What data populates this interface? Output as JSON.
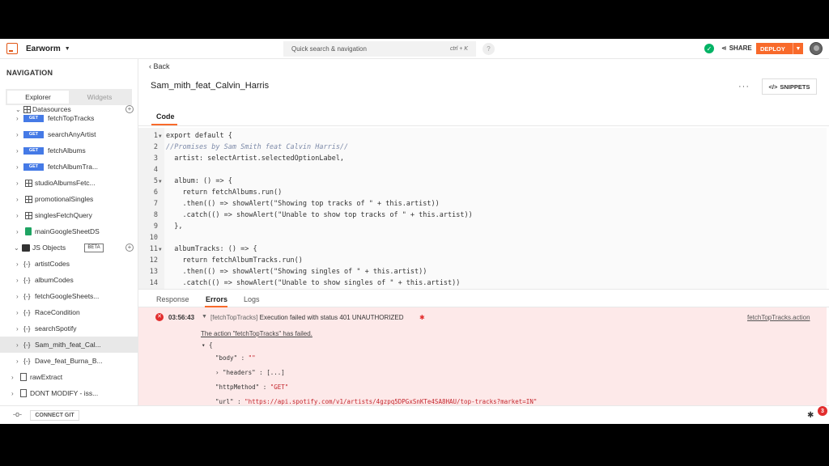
{
  "header": {
    "app_name": "Earworm",
    "search_placeholder": "Quick search & navigation",
    "search_shortcut": "ctrl + K",
    "help": "?",
    "share_label": "SHARE",
    "deploy_label": "DEPLOY"
  },
  "sidebar": {
    "title": "NAVIGATION",
    "tabs": [
      "Explorer",
      "Widgets"
    ],
    "datasources_label": "Datasources",
    "queries": [
      {
        "method": "GET",
        "label": "fetchTopTracks"
      },
      {
        "method": "GET",
        "label": "searchAnyArtist"
      },
      {
        "method": "GET",
        "label": "fetchAlbums"
      },
      {
        "method": "GET",
        "label": "fetchAlbumTra..."
      }
    ],
    "sql_queries": [
      "studioAlbumsFetc...",
      "promotionalSingles",
      "singlesFetchQuery"
    ],
    "sheet_query": "mainGoogleSheetDS",
    "js_objects_label": "JS Objects",
    "beta": "BETA",
    "js_objects": [
      "artistCodes",
      "albumCodes",
      "fetchGoogleSheets...",
      "RaceCondition",
      "searchSpotify",
      "Sam_mith_feat_Cal...",
      "Dave_feat_Burna_B..."
    ],
    "js_icon": "{-}",
    "pages": [
      "rawExtract",
      "DONT MODIFY - iss..."
    ]
  },
  "main": {
    "back_label": "Back",
    "title": "Sam_mith_feat_Calvin_Harris",
    "more": "···",
    "snippets_label": "SNIPPETS",
    "code_tab": "Code",
    "code_lines": [
      {
        "n": "1",
        "text": "export default {"
      },
      {
        "n": "2",
        "text": "//Promises by Sam Smith feat Calvin Harris//"
      },
      {
        "n": "3",
        "text": "  artist: selectArtist.selectedOptionLabel,"
      },
      {
        "n": "4",
        "text": ""
      },
      {
        "n": "5",
        "text": "  album: () => {"
      },
      {
        "n": "6",
        "text": "    return fetchAlbums.run()"
      },
      {
        "n": "7",
        "text": "    .then(() => showAlert(\"Showing top tracks of \" + this.artist))"
      },
      {
        "n": "8",
        "text": "    .catch(() => showAlert(\"Unable to show top tracks of \" + this.artist))"
      },
      {
        "n": "9",
        "text": "  },"
      },
      {
        "n": "10",
        "text": ""
      },
      {
        "n": "11",
        "text": "  albumTracks: () => {"
      },
      {
        "n": "12",
        "text": "    return fetchAlbumTracks.run()"
      },
      {
        "n": "13",
        "text": "    .then(() => showAlert(\"Showing singles of \" + this.artist))"
      },
      {
        "n": "14",
        "text": "    .catch(() => showAlert(\"Unable to show singles of \" + this.artist))"
      }
    ],
    "bottom_tabs": [
      "Response",
      "Errors",
      "Logs"
    ],
    "error": {
      "time": "03:56:43",
      "tag": "[fetchTopTracks]",
      "message": "Execution failed with status 401 UNAUTHORIZED",
      "link": "fetchTopTracks.action",
      "failed": "The action \"fetchTopTracks\" has failed.",
      "json": {
        "open": "{",
        "body_key": "\"body\" : ",
        "body_val": "\"\"",
        "headers_key": "\"headers\" : ",
        "headers_val": "[...]",
        "method_key": "\"httpMethod\" : ",
        "method_val": "\"GET\"",
        "url_key": "\"url\" : ",
        "url_val": "\"https://api.spotify.com/v1/artists/4gzpq5DPGxSnKTe4SA8HAU/top-tracks?market=IN\""
      }
    }
  },
  "statusbar": {
    "connect_git": "CONNECT GIT",
    "debug_count": "3"
  }
}
